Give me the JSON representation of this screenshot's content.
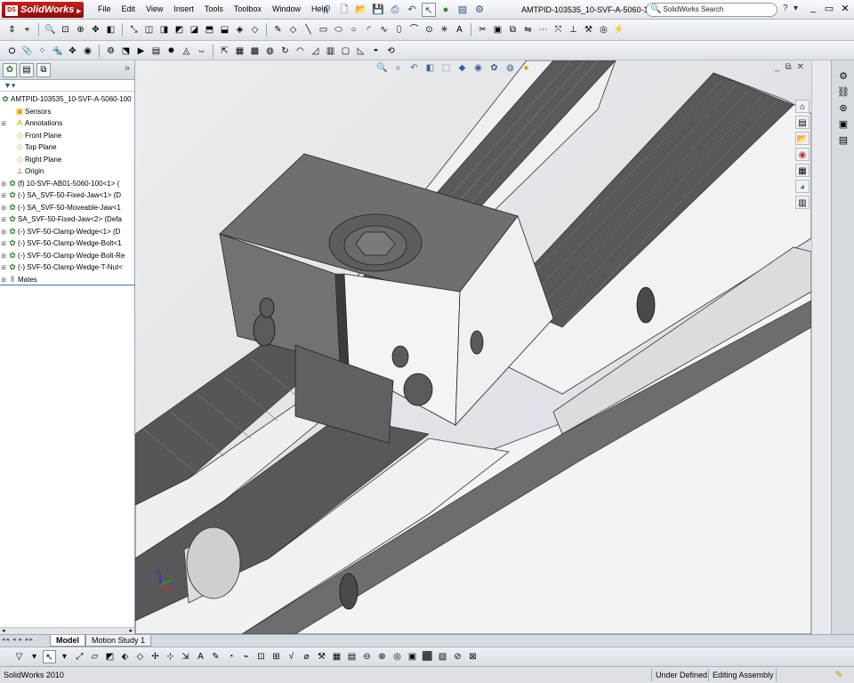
{
  "app": {
    "name": "SolidWorks",
    "ds_mark": "DS"
  },
  "menu": [
    "File",
    "Edit",
    "View",
    "Insert",
    "Tools",
    "Toolbox",
    "Window",
    "Help"
  ],
  "document_title": "AMTPID-103535_10-SVF-A-5060-1...",
  "search": {
    "placeholder": "SolidWorks Search"
  },
  "title_right": {
    "help": "?",
    "help_arrow": "▾",
    "minimize": "_",
    "restore": "▭",
    "close": "✕"
  },
  "feature_tree": {
    "filter": "▼▾",
    "root": "AMTPID-103535_10-SVF-A-5060-100",
    "nodes": [
      {
        "expand": "",
        "icon": "sensor-icon",
        "label": "Sensors"
      },
      {
        "expand": "⊞",
        "icon": "annotation-icon",
        "label": "Annotations"
      },
      {
        "expand": "",
        "icon": "plane-icon",
        "label": "Front Plane"
      },
      {
        "expand": "",
        "icon": "plane-icon",
        "label": "Top Plane"
      },
      {
        "expand": "",
        "icon": "plane-icon",
        "label": "Right Plane"
      },
      {
        "expand": "",
        "icon": "origin-icon",
        "label": "Origin"
      },
      {
        "expand": "⊞",
        "icon": "assembly-icon",
        "label": "(f) 10-SVF-AB01-5060-100<1> ("
      },
      {
        "expand": "⊞",
        "icon": "assembly-icon",
        "label": "(-) SA_SVF-50-Fixed-Jaw<1> (D"
      },
      {
        "expand": "⊞",
        "icon": "assembly-icon",
        "label": "(-) SA_SVF-50-Moveable-Jaw<1"
      },
      {
        "expand": "⊞",
        "icon": "assembly-icon",
        "label": "SA_SVF-50-Fixed-Jaw<2> (Defa"
      },
      {
        "expand": "⊞",
        "icon": "assembly-icon",
        "label": "(-) SVF-50-Clamp-Wedge<1> (D"
      },
      {
        "expand": "⊞",
        "icon": "assembly-icon",
        "label": "(-) SVF-50-Clamp-Wedge-Bolt<1"
      },
      {
        "expand": "⊞",
        "icon": "assembly-icon",
        "label": "(-) SVF-50-Clamp-Wedge-Bolt-Re"
      },
      {
        "expand": "⊞",
        "icon": "assembly-icon",
        "label": "(-) SVF-50-Clamp-Wedge-T-Nut<"
      },
      {
        "expand": "⊞",
        "icon": "mates-icon",
        "label": "Mates"
      }
    ]
  },
  "bottom_tabs": {
    "nav": "◂◂ ◂ ▸ ▸▸",
    "model": "Model",
    "motion": "Motion Study 1"
  },
  "status": {
    "app_version": "SolidWorks 2010",
    "definition": "Under Defined",
    "mode": "Editing Assembly",
    "extra": "",
    "help_icon": "?"
  },
  "viewport_controls": {
    "minimize": "_",
    "restore": "⧉",
    "close": "✕"
  },
  "colors": {
    "accent": "#3a6fbf",
    "logo_red": "#b0100e",
    "background": "#dfe2e6",
    "part_face_light": "#f1f1f1",
    "part_face_mid": "#6e6e72",
    "part_face_dark": "#3d3d40"
  }
}
